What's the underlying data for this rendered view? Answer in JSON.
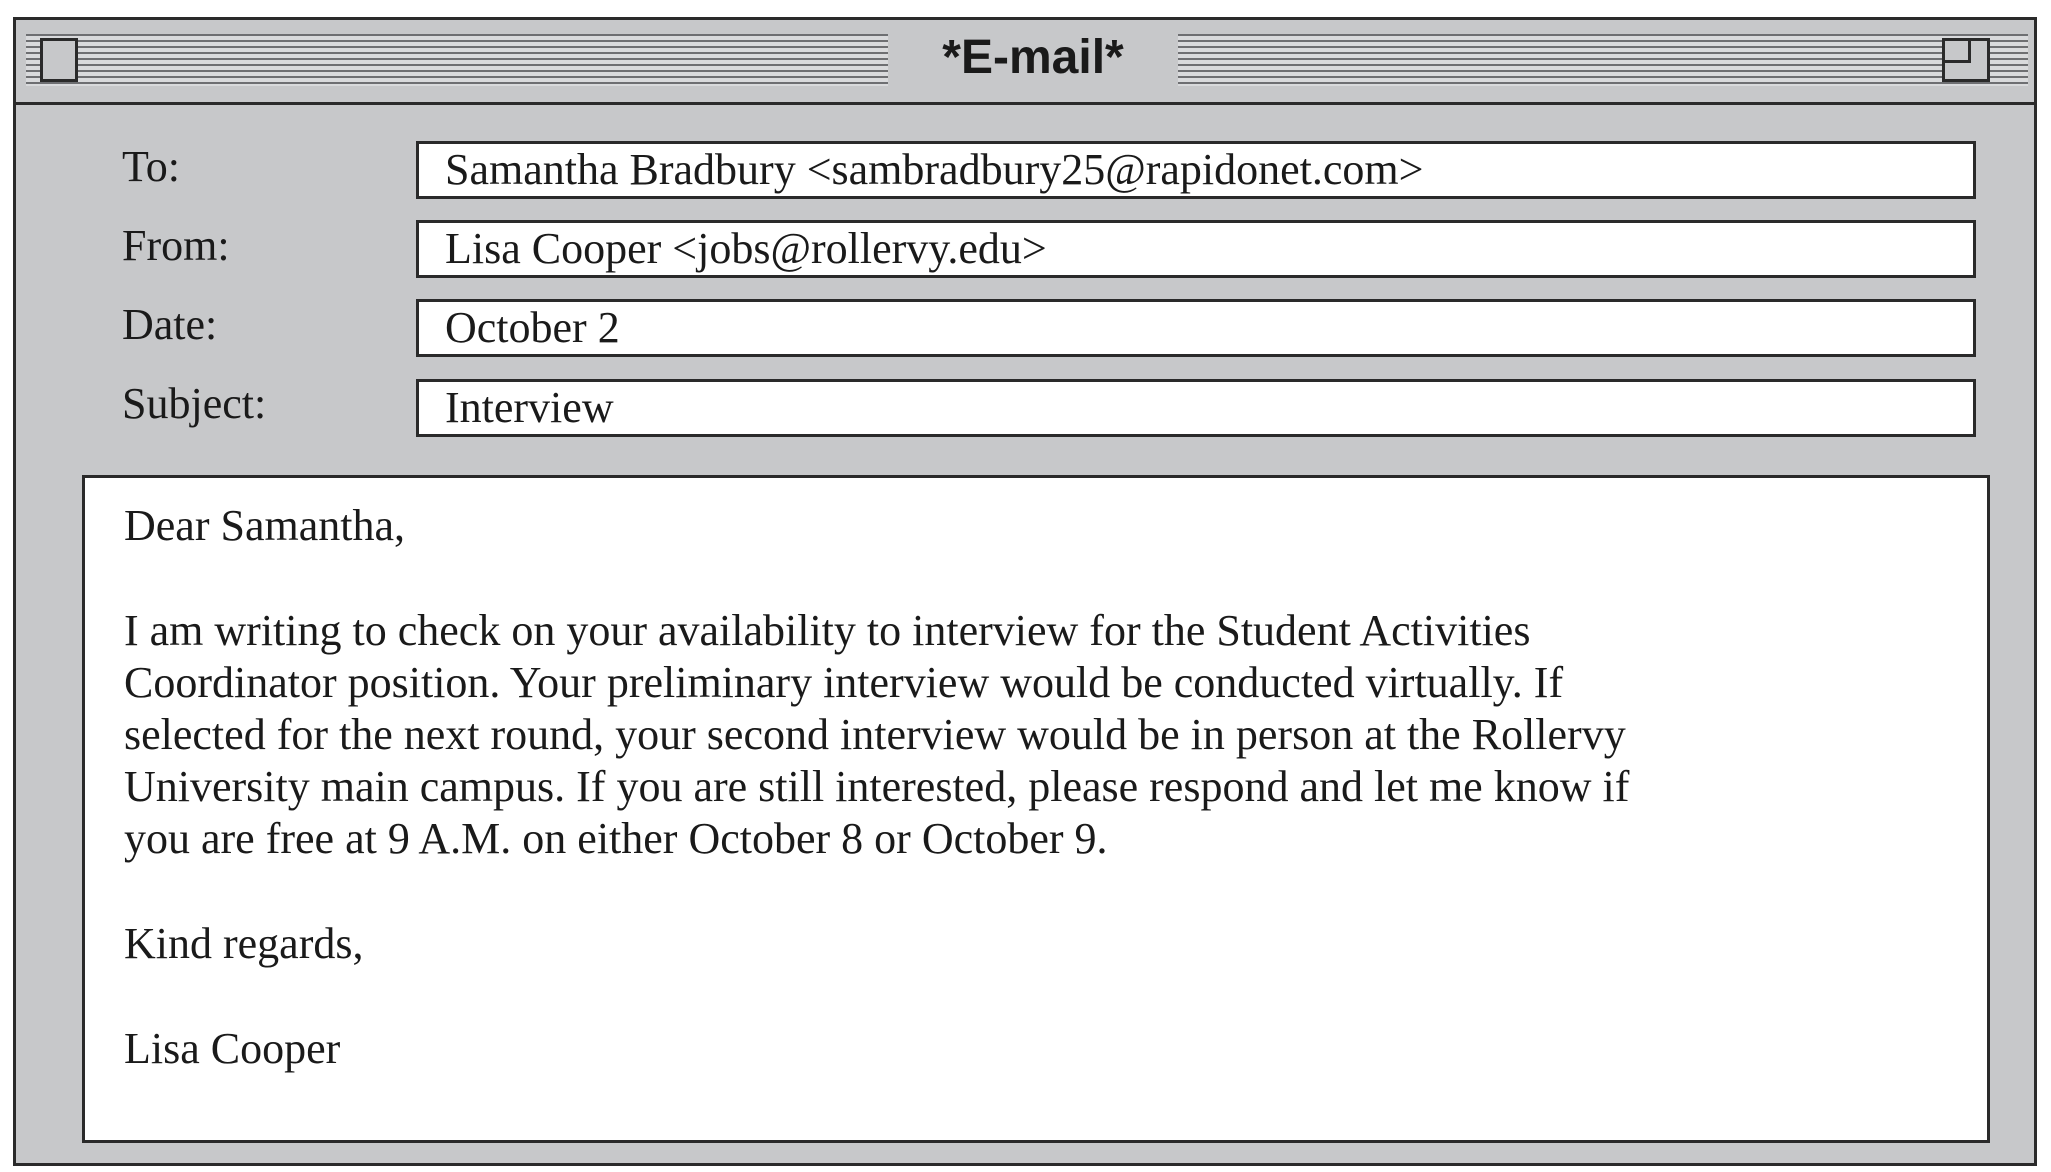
{
  "window": {
    "title": "*E-mail*"
  },
  "header": {
    "to_label": "To:",
    "to_value": "Samantha Bradbury <sambradbury25@rapidonet.com>",
    "from_label": "From:",
    "from_value": "Lisa Cooper <jobs@rollervy.edu>",
    "date_label": "Date:",
    "date_value": "October 2",
    "subject_label": "Subject:",
    "subject_value": "Interview"
  },
  "message": {
    "greeting": "Dear Samantha,",
    "body_lines": [
      "I am writing to check on your availability to interview for the Student Activities",
      "Coordinator position. Your preliminary interview would be conducted virtually. If",
      "selected for the next round, your second interview would be in person at the Rollervy",
      "University main campus. If you are still interested, please respond and let me know if",
      "you are free at 9 A.M. on either October 8 or October 9."
    ],
    "closing": "Kind regards,",
    "signature": "Lisa Cooper"
  }
}
